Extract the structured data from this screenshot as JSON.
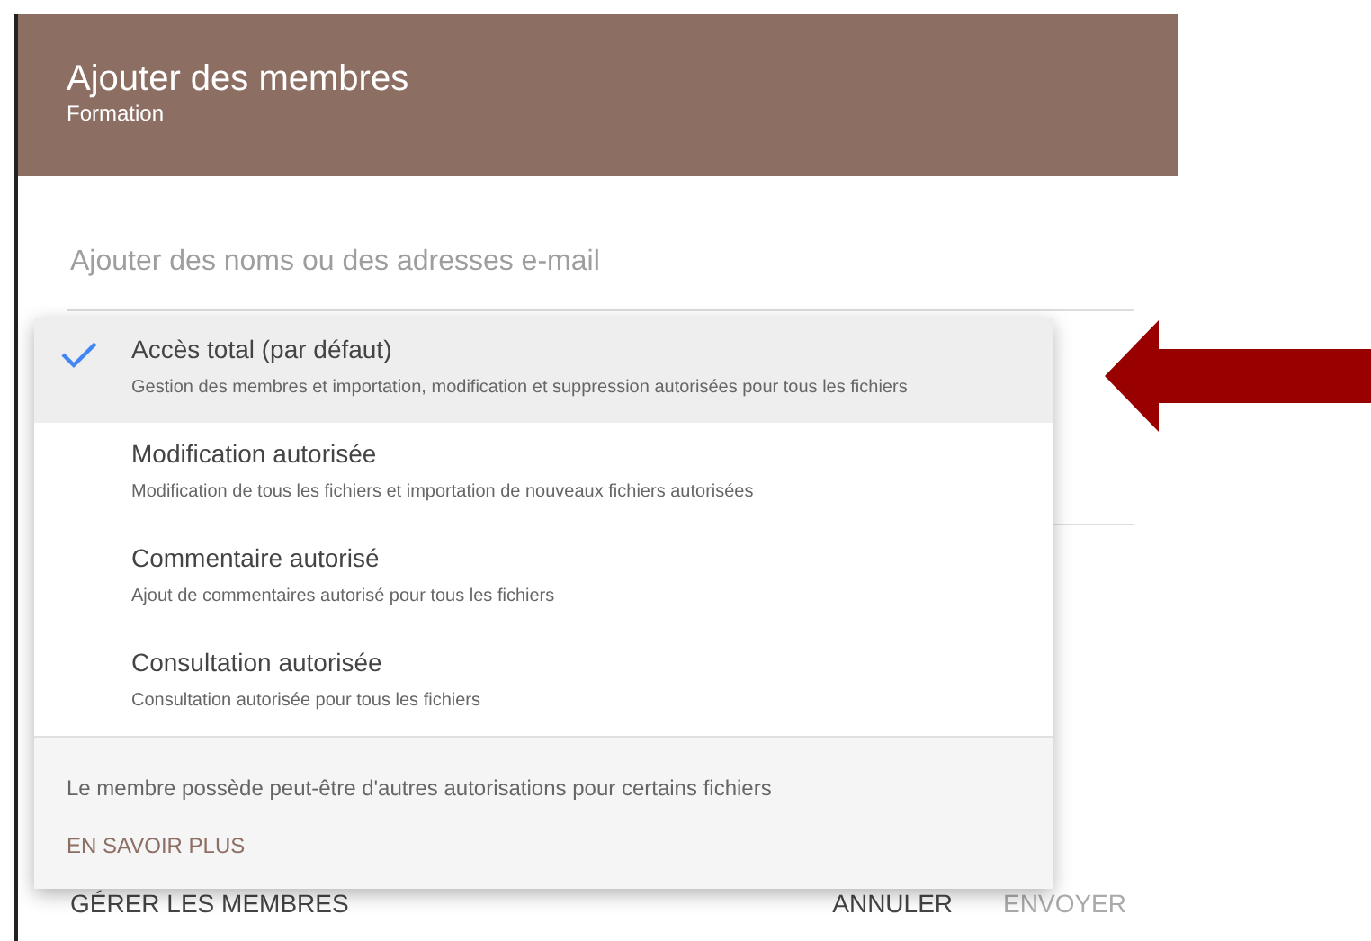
{
  "dialog": {
    "title": "Ajouter des membres",
    "subtitle": "Formation",
    "input": {
      "placeholder": "Ajouter des noms ou des adresses e-mail"
    },
    "buttons": [
      {
        "label": "GÉRER LES MEMBRES",
        "disabled": false
      },
      {
        "label": "ANNULER",
        "disabled": false
      },
      {
        "label": "ENVOYER",
        "disabled": true
      }
    ]
  },
  "menu": {
    "items": [
      {
        "label": "Accès total (par défaut)",
        "description": "Gestion des membres et importation, modification et suppression autorisées pour tous les fichiers",
        "selected": true
      },
      {
        "label": "Modification autorisée",
        "description": "Modification de tous les fichiers et importation de nouveaux fichiers autorisées",
        "selected": false
      },
      {
        "label": "Commentaire autorisé",
        "description": "Ajout de commentaires autorisé pour tous les fichiers",
        "selected": false
      },
      {
        "label": "Consultation autorisée",
        "description": "Consultation autorisée pour tous les fichiers",
        "selected": false
      }
    ],
    "note": "Le membre possède peut-être d'autres autorisations pour certains fichiers",
    "link": "EN SAVOIR PLUS"
  }
}
